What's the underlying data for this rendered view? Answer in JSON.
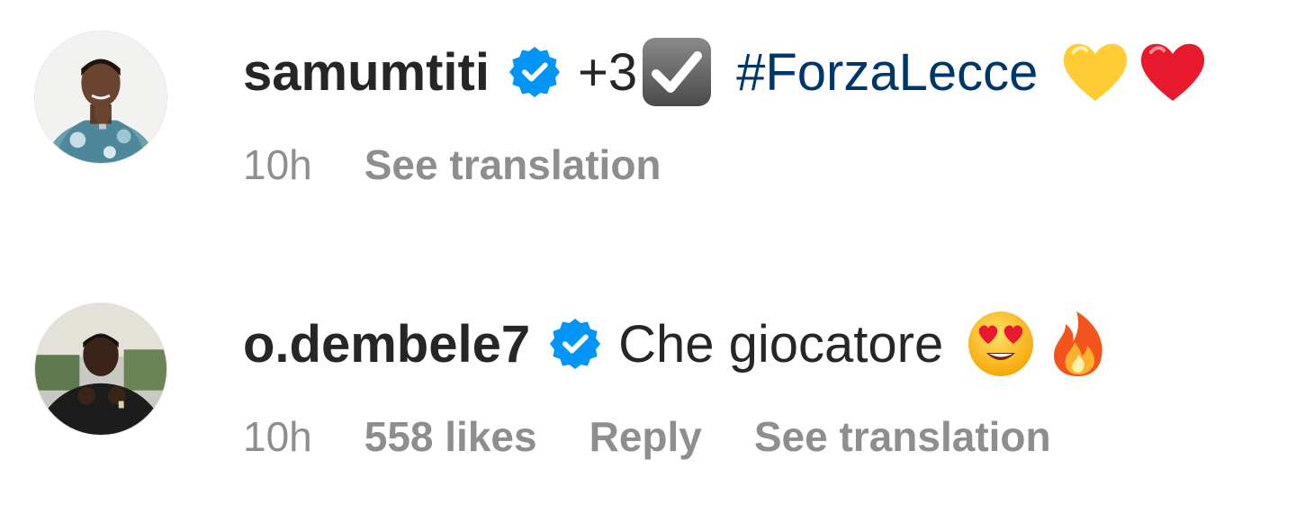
{
  "comments": [
    {
      "username": "samumtiti",
      "verified": true,
      "text_before": "+3",
      "inline_emoji": "check-mark-button",
      "hashtag": "#ForzaLecce",
      "trailing_emojis": [
        "yellow-heart",
        "red-heart"
      ],
      "time": "10h",
      "see_translation": "See translation"
    },
    {
      "username": "o.dembele7",
      "verified": true,
      "text": "Che giocatore",
      "trailing_emojis": [
        "heart-eyes-face",
        "fire"
      ],
      "time": "10h",
      "likes": "558 likes",
      "reply": "Reply",
      "see_translation": "See translation"
    }
  ],
  "colors": {
    "username": "#262626",
    "text": "#262626",
    "meta": "#8e8e8e",
    "hashtag": "#00376b",
    "verified_badge": "#0095f6"
  }
}
